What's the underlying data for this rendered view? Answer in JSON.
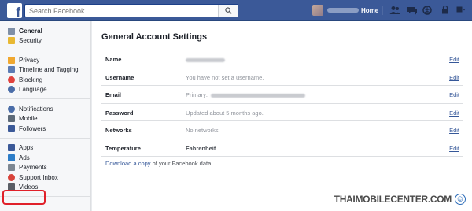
{
  "header": {
    "logo": "f",
    "search": {
      "placeholder": "Search Facebook"
    },
    "home_label": "Home"
  },
  "sidebar": {
    "groups": [
      [
        {
          "label": "General",
          "icon": "gear-icon",
          "active": true
        },
        {
          "label": "Security",
          "icon": "shield-icon"
        }
      ],
      [
        {
          "label": "Privacy",
          "icon": "lock-icon"
        },
        {
          "label": "Timeline and Tagging",
          "icon": "timeline-icon"
        },
        {
          "label": "Blocking",
          "icon": "block-icon"
        },
        {
          "label": "Language",
          "icon": "globe-icon"
        }
      ],
      [
        {
          "label": "Notifications",
          "icon": "globe-icon"
        },
        {
          "label": "Mobile",
          "icon": "mobile-icon"
        },
        {
          "label": "Followers",
          "icon": "rss-icon"
        }
      ],
      [
        {
          "label": "Apps",
          "icon": "apps-icon"
        },
        {
          "label": "Ads",
          "icon": "ads-icon"
        },
        {
          "label": "Payments",
          "icon": "card-icon"
        },
        {
          "label": "Support Inbox",
          "icon": "lifebuoy-icon"
        },
        {
          "label": "Videos",
          "icon": "film-icon"
        }
      ]
    ]
  },
  "main": {
    "title": "General Account Settings",
    "rows": [
      {
        "label": "Name",
        "value": "",
        "edit": "Edit"
      },
      {
        "label": "Username",
        "value": "You have not set a username.",
        "edit": "Edit"
      },
      {
        "label": "Email",
        "value": "Primary:",
        "edit": "Edit"
      },
      {
        "label": "Password",
        "value": "Updated about 5 months ago.",
        "edit": "Edit"
      },
      {
        "label": "Networks",
        "value": "No networks.",
        "edit": "Edit"
      },
      {
        "label": "Temperature",
        "value": "Fahrenheit",
        "edit": "Edit"
      }
    ],
    "download_link": "Download a copy",
    "download_suffix": " of your Facebook data."
  },
  "watermark": {
    "text": "THAIMOBILECENTER.COM",
    "symbol": "©"
  },
  "colors": {
    "brand": "#3b5998",
    "link": "#365899",
    "highlight": "#e0202a"
  }
}
